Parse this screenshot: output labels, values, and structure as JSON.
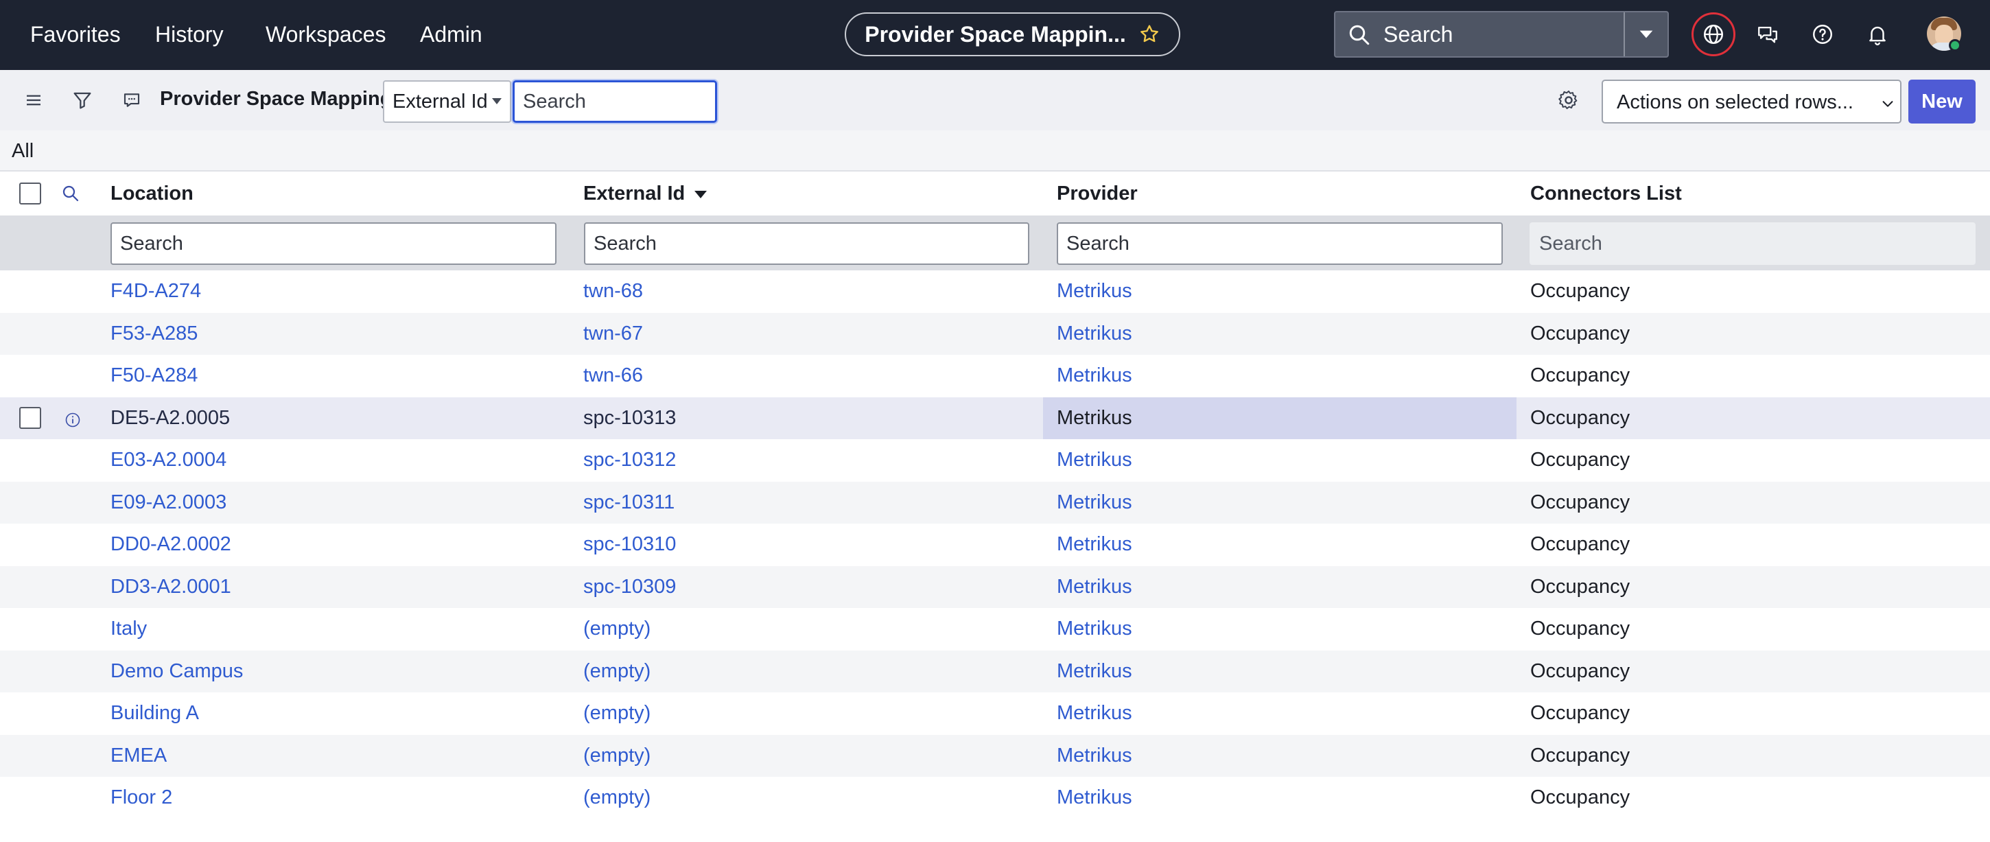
{
  "nav": {
    "links": [
      "Favorites",
      "History",
      "Workspaces",
      "Admin"
    ],
    "page_title": "Provider Space Mappin...",
    "search_label": "Search",
    "accent_color": "#e0303a"
  },
  "toolbar": {
    "list_title": "Provider Space Mappings",
    "search_field": "External Id",
    "search_placeholder": "Search",
    "actions_label": "Actions on selected rows...",
    "new_label": "New"
  },
  "breadcrumb": "All",
  "columns": {
    "location": "Location",
    "external_id": "External Id",
    "provider": "Provider",
    "connectors_list": "Connectors List",
    "sort_column": "External Id",
    "sort_direction": "descending"
  },
  "filters": {
    "location_placeholder": "Search",
    "external_id_placeholder": "Search",
    "provider_placeholder": "Search",
    "connectors_placeholder": "Search"
  },
  "rows": [
    {
      "location": "F4D-A274",
      "external_id": "twn-68",
      "provider": "Metrikus",
      "connectors": "Occupancy"
    },
    {
      "location": "F53-A285",
      "external_id": "twn-67",
      "provider": "Metrikus",
      "connectors": "Occupancy"
    },
    {
      "location": "F50-A284",
      "external_id": "twn-66",
      "provider": "Metrikus",
      "connectors": "Occupancy"
    },
    {
      "location": "DE5-A2.0005",
      "external_id": "spc-10313",
      "provider": "Metrikus",
      "connectors": "Occupancy"
    },
    {
      "location": "E03-A2.0004",
      "external_id": "spc-10312",
      "provider": "Metrikus",
      "connectors": "Occupancy"
    },
    {
      "location": "E09-A2.0003",
      "external_id": "spc-10311",
      "provider": "Metrikus",
      "connectors": "Occupancy"
    },
    {
      "location": "DD0-A2.0002",
      "external_id": "spc-10310",
      "provider": "Metrikus",
      "connectors": "Occupancy"
    },
    {
      "location": "DD3-A2.0001",
      "external_id": "spc-10309",
      "provider": "Metrikus",
      "connectors": "Occupancy"
    },
    {
      "location": "Italy",
      "external_id": "(empty)",
      "provider": "Metrikus",
      "connectors": "Occupancy"
    },
    {
      "location": "Demo Campus",
      "external_id": "(empty)",
      "provider": "Metrikus",
      "connectors": "Occupancy"
    },
    {
      "location": "Building A",
      "external_id": "(empty)",
      "provider": "Metrikus",
      "connectors": "Occupancy"
    },
    {
      "location": "EMEA",
      "external_id": "(empty)",
      "provider": "Metrikus",
      "connectors": "Occupancy"
    },
    {
      "location": "Floor 2",
      "external_id": "(empty)",
      "provider": "Metrikus",
      "connectors": "Occupancy"
    }
  ]
}
